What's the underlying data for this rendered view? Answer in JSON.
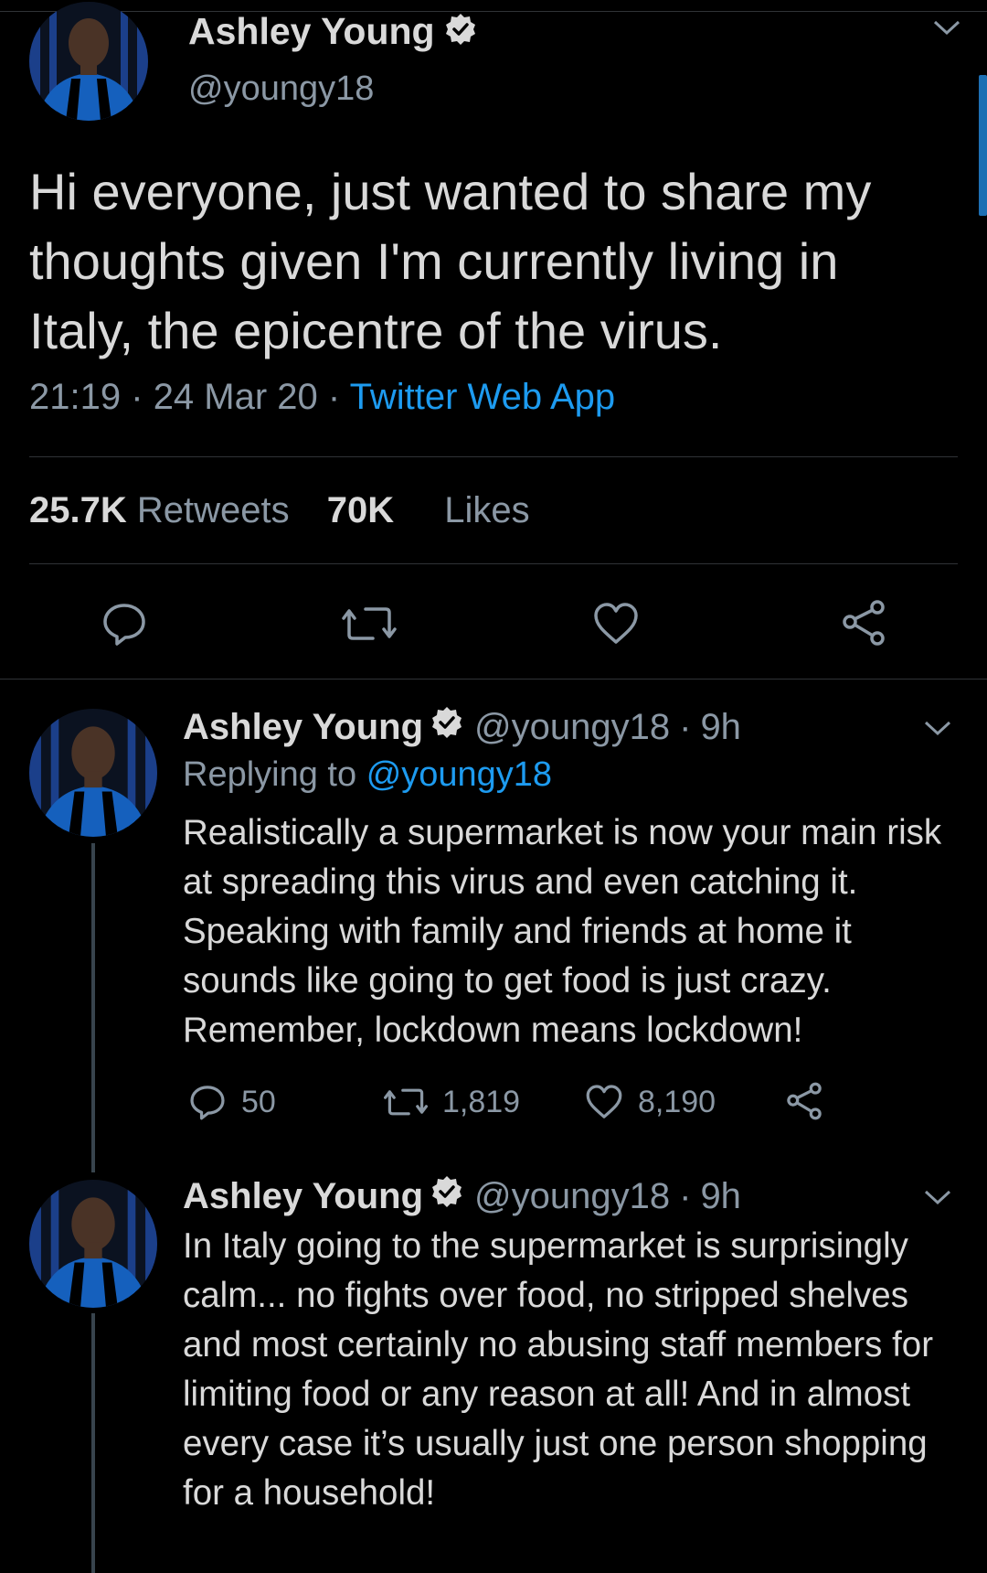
{
  "main_tweet": {
    "author": {
      "display_name": "Ashley Young",
      "handle": "@youngy18",
      "verified": true,
      "avatar_icon": "avatar-icon"
    },
    "text": "Hi everyone, just wanted to share my thoughts given I'm currently living in Italy, the epicentre of the virus.",
    "time": "21:19",
    "date": "24 Mar 20",
    "separator": "·",
    "source": "Twitter Web App",
    "stats": {
      "retweets_count": "25.7K",
      "retweets_label": "Retweets",
      "likes_count": "70K",
      "likes_label": "Likes"
    },
    "actions": [
      "reply-icon",
      "retweet-icon",
      "like-icon",
      "share-icon"
    ]
  },
  "replies": [
    {
      "display_name": "Ashley Young",
      "handle": "@youngy18",
      "time_ago": "9h",
      "replying_to_label": "Replying to",
      "replying_to_handle": "@youngy18",
      "text": "Realistically a supermarket is now your main risk at spreading this virus and even catching it. Speaking with family and friends at home it sounds like going to get food is just crazy. Remember, lockdown means lockdown!",
      "reply_count": "50",
      "retweet_count": "1,819",
      "like_count": "8,190"
    },
    {
      "display_name": "Ashley Young",
      "handle": "@youngy18",
      "time_ago": "9h",
      "text": "In Italy going to the supermarket is surprisingly calm... no fights over food, no stripped shelves and most certainly no abusing staff members for limiting food or any reason at all! And in almost every case it’s usually just one person shopping for a household!"
    }
  ],
  "colors": {
    "background": "#000000",
    "primary_text": "#d9d9d9",
    "secondary_text": "#8b98a5",
    "link": "#1d9bf0",
    "divider": "#2f3336"
  }
}
